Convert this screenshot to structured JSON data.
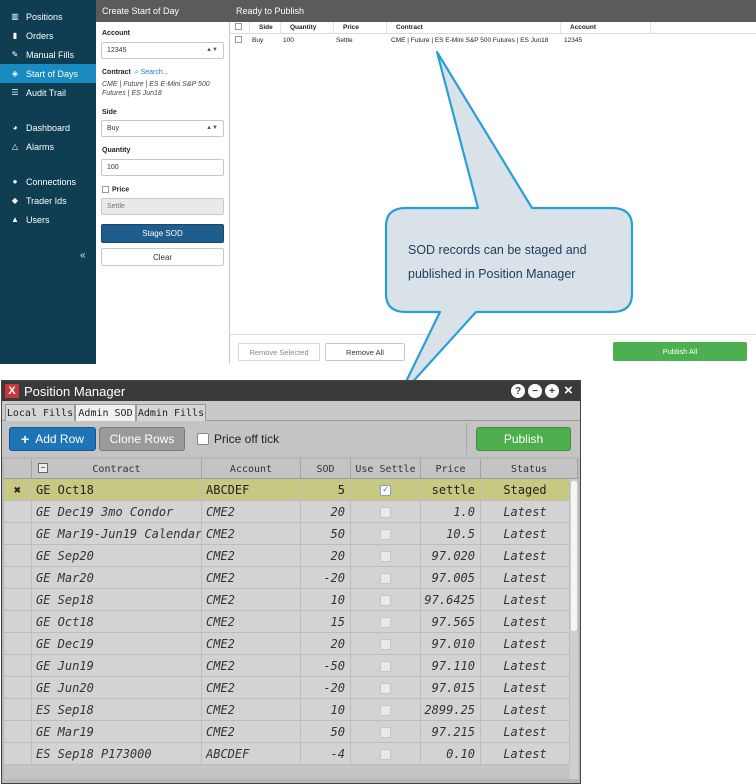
{
  "sidebar": {
    "items": [
      {
        "label": "Positions",
        "icon": "bar-chart-icon"
      },
      {
        "label": "Orders",
        "icon": "book-icon"
      },
      {
        "label": "Manual Fills",
        "icon": "wrench-icon"
      },
      {
        "label": "Start of Days",
        "icon": "tag-icon"
      },
      {
        "label": "Audit Trail",
        "icon": "list-icon"
      },
      {
        "label": "Dashboard",
        "icon": "gauge-icon"
      },
      {
        "label": "Alarms",
        "icon": "bell-icon"
      },
      {
        "label": "Connections",
        "icon": "globe-icon"
      },
      {
        "label": "Trader Ids",
        "icon": "tags-icon"
      },
      {
        "label": "Users",
        "icon": "user-icon"
      }
    ],
    "collapse": "«"
  },
  "form": {
    "title": "Create Start of Day",
    "account_label": "Account",
    "account_value": "12345",
    "contract_label": "Contract",
    "search_link": "Search...",
    "contract_value": "CME | Future | ES E-Mini S&P 500 Futures | ES Jun18",
    "side_label": "Side",
    "side_value": "Buy",
    "quantity_label": "Quantity",
    "quantity_value": "100",
    "price_label": "Price",
    "price_value": "Settle",
    "stage_button": "Stage SOD",
    "clear_button": "Clear"
  },
  "publish": {
    "title": "Ready to Publish",
    "columns": [
      "Side",
      "Quantity",
      "Price",
      "Contract",
      "Account"
    ],
    "rows": [
      {
        "side": "Buy",
        "quantity": "100",
        "price": "Settle",
        "contract": "CME | Future | ES E-Mini S&P 500 Futures | ES Jun18",
        "account": "12345"
      }
    ],
    "remove_selected": "Remove Selected",
    "remove_all": "Remove All",
    "publish_all": "Publish All"
  },
  "callout": {
    "text": "SOD records can be staged and published in Position Manager"
  },
  "position_manager": {
    "title": "Position Manager",
    "logo": "X",
    "window_buttons": {
      "help": "?",
      "minimize": "−",
      "maximize": "+",
      "close": "×"
    },
    "tabs": [
      "Local Fills",
      "Admin SOD",
      "Admin Fills"
    ],
    "active_tab": "Admin SOD",
    "toolbar": {
      "add_row": "Add Row",
      "clone_rows": "Clone Rows",
      "price_off_tick": "Price off tick",
      "publish": "Publish"
    },
    "columns": [
      "Contract",
      "Account",
      "SOD",
      "Use Settle",
      "Price",
      "Status"
    ],
    "header_box": "−",
    "row_delete_mark": "✖",
    "rows": [
      {
        "contract": "GE Oct18",
        "account": "ABCDEF",
        "sod": "5",
        "use_settle": true,
        "price": "settle",
        "status": "Staged"
      },
      {
        "contract": "GE Dec19 3mo Condor",
        "account": "CME2",
        "sod": "20",
        "use_settle": false,
        "price": "1.0",
        "status": "Latest"
      },
      {
        "contract": "GE Mar19-Jun19 Calendar",
        "account": "CME2",
        "sod": "50",
        "use_settle": false,
        "price": "10.5",
        "status": "Latest"
      },
      {
        "contract": "GE Sep20",
        "account": "CME2",
        "sod": "20",
        "use_settle": false,
        "price": "97.020",
        "status": "Latest"
      },
      {
        "contract": "GE Mar20",
        "account": "CME2",
        "sod": "-20",
        "use_settle": false,
        "price": "97.005",
        "status": "Latest"
      },
      {
        "contract": "GE Sep18",
        "account": "CME2",
        "sod": "10",
        "use_settle": false,
        "price": "97.6425",
        "status": "Latest"
      },
      {
        "contract": "GE Oct18",
        "account": "CME2",
        "sod": "15",
        "use_settle": false,
        "price": "97.565",
        "status": "Latest"
      },
      {
        "contract": "GE Dec19",
        "account": "CME2",
        "sod": "20",
        "use_settle": false,
        "price": "97.010",
        "status": "Latest"
      },
      {
        "contract": "GE Jun19",
        "account": "CME2",
        "sod": "-50",
        "use_settle": false,
        "price": "97.110",
        "status": "Latest"
      },
      {
        "contract": "GE Jun20",
        "account": "CME2",
        "sod": "-20",
        "use_settle": false,
        "price": "97.015",
        "status": "Latest"
      },
      {
        "contract": "ES Sep18",
        "account": "CME2",
        "sod": "10",
        "use_settle": false,
        "price": "2899.25",
        "status": "Latest"
      },
      {
        "contract": "GE Mar19",
        "account": "CME2",
        "sod": "50",
        "use_settle": false,
        "price": "97.215",
        "status": "Latest"
      },
      {
        "contract": "ES Sep18 P173000",
        "account": "ABCDEF",
        "sod": "-4",
        "use_settle": false,
        "price": "0.10",
        "status": "Latest"
      }
    ]
  },
  "colors": {
    "sidebar_bg": "#0f3d52",
    "sidebar_active": "#1a8bc0",
    "panel_header": "#5b5b5b",
    "primary_blue": "#1e5d8c",
    "publish_green": "#4caf50",
    "callout_fill": "#d9e2e8",
    "callout_stroke": "#2a9fd6",
    "selected_row": "#c7c882"
  }
}
